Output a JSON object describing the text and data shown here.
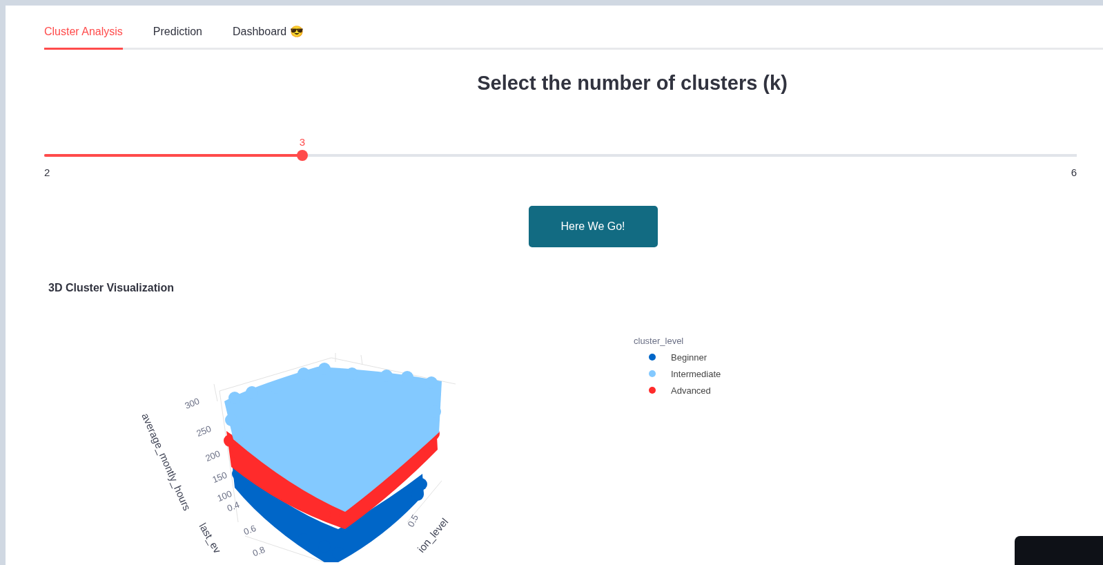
{
  "tabs": [
    {
      "label": "Cluster Analysis",
      "selected": true
    },
    {
      "label": "Prediction",
      "selected": false
    },
    {
      "label": "Dashboard 😎",
      "selected": false
    }
  ],
  "heading": "Select the number of clusters (k)",
  "slider": {
    "value": "3",
    "level": 0.25,
    "min": "2",
    "max": "6"
  },
  "button": {
    "label": "Here We Go!"
  },
  "chart": {
    "title": "3D Cluster Visualization",
    "z_ticks": [
      "300",
      "250",
      "200",
      "150",
      "100"
    ],
    "x_ticks": [
      "0.4",
      "0.6",
      "0.8"
    ],
    "y_ticks": [
      "0.5"
    ],
    "z_title": "average_montly_hours",
    "x_title": "last_ev",
    "y_title": "ion_level",
    "legend_title": "cluster_level",
    "legend": [
      {
        "label": "Beginner",
        "color": "#0066c8"
      },
      {
        "label": "Intermediate",
        "color": "#83c9ff"
      },
      {
        "label": "Advanced",
        "color": "#ff2b2b"
      }
    ]
  }
}
